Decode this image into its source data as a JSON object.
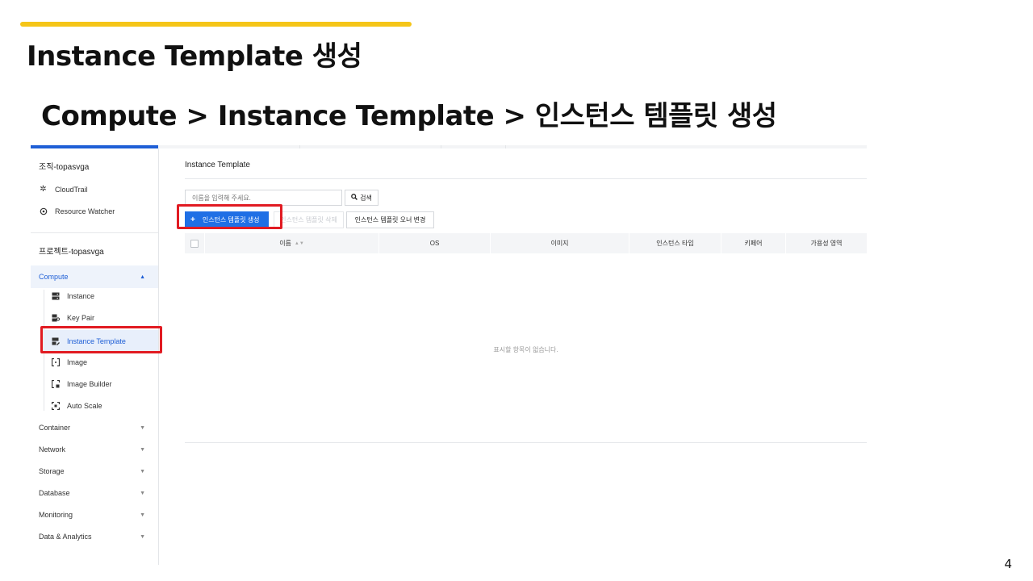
{
  "slide": {
    "title": "Instance Template 생성",
    "path": "Compute  >  Instance Template  >  인스턴스 템플릿 생성",
    "page_number": "4",
    "accent_color": "#f5c518"
  },
  "sidebar": {
    "org_label": "조직-topasvga",
    "org_items": [
      {
        "label": "CloudTrail",
        "icon": "cloudtrail-icon"
      },
      {
        "label": "Resource Watcher",
        "icon": "resource-watcher-icon"
      }
    ],
    "project_label": "프로젝트-topasvga",
    "compute_label": "Compute",
    "compute_items": [
      {
        "label": "Instance",
        "icon": "server-icon"
      },
      {
        "label": "Key Pair",
        "icon": "key-icon"
      },
      {
        "label": "Instance Template",
        "icon": "template-icon"
      },
      {
        "label": "Image",
        "icon": "image-icon"
      },
      {
        "label": "Image Builder",
        "icon": "image-builder-icon"
      },
      {
        "label": "Auto Scale",
        "icon": "auto-scale-icon"
      }
    ],
    "categories": [
      "Container",
      "Network",
      "Storage",
      "Database",
      "Monitoring",
      "Data & Analytics"
    ]
  },
  "main": {
    "title": "Instance Template",
    "search_placeholder": "이름을 입력해 주세요.",
    "search_button": "검색",
    "create_button": "인스턴스 템플릿 생성",
    "delete_button": "인스턴스 템플릿 삭제",
    "owner_button": "인스턴스 템플릿 오너 변경",
    "columns": [
      "이름",
      "OS",
      "이미지",
      "인스턴스 타입",
      "키페어",
      "가용성 영역"
    ],
    "empty_message": "표시할 항목이 없습니다.",
    "primary_color": "#1f6fe5",
    "highlight_color": "#e11b22"
  }
}
